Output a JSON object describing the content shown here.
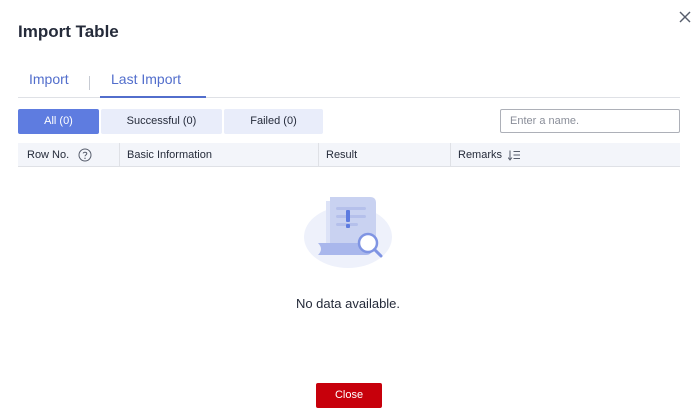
{
  "dialog": {
    "title": "Import Table",
    "close_icon": "close-icon"
  },
  "tabs": [
    {
      "label": "Import",
      "active": false
    },
    {
      "label": "Last Import",
      "active": true
    }
  ],
  "filters": [
    {
      "label": "All (0)",
      "active": true
    },
    {
      "label": "Successful (0)",
      "active": false
    },
    {
      "label": "Failed (0)",
      "active": false
    }
  ],
  "search": {
    "placeholder": "Enter a name.",
    "value": ""
  },
  "table": {
    "columns": [
      "Row No.",
      "Basic Information",
      "Result",
      "Remarks"
    ],
    "rows": []
  },
  "empty_state": {
    "text": "No data available.",
    "icon": "no-data-illustration"
  },
  "footer": {
    "close_label": "Close"
  },
  "colors": {
    "accent": "#5e7ce0",
    "tab_text": "#526ecc",
    "danger": "#c7000b",
    "header_bg": "#f3f5fa"
  }
}
